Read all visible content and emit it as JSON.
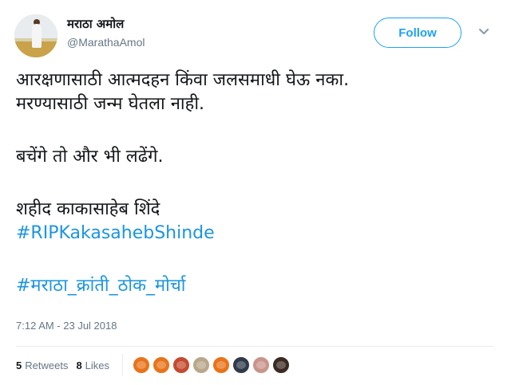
{
  "user": {
    "display_name": "मराठा अमोल",
    "handle": "@MarathaAmol"
  },
  "follow_button": {
    "label": "Follow"
  },
  "tweet": {
    "lines": [
      "आरक्षणासाठी आत्मदहन किंवा जलसमाधी घेऊ नका.",
      "मरण्यासाठी जन्म घेतला नाही.",
      "बचेंगे तो और भी लढेंगे.",
      "शहीद काकासाहेब शिंदे"
    ],
    "hashtags": [
      "#RIPKakasahebShinde",
      "#मराठा_क्रांती_ठोक_मोर्चा"
    ]
  },
  "timestamp": "7:12 AM - 23 Jul 2018",
  "stats": {
    "retweets_count": "5",
    "retweets_label": "Retweets",
    "likes_count": "8",
    "likes_label": "Likes"
  },
  "liker_avatars": [
    {
      "color": "#e8731a"
    },
    {
      "color": "#e8731a"
    },
    {
      "color": "#c44b2e"
    },
    {
      "color": "#b9a78a"
    },
    {
      "color": "#e8731a"
    },
    {
      "color": "#2f3a4a"
    },
    {
      "color": "#c9948a"
    },
    {
      "color": "#3b2a22"
    }
  ],
  "colors": {
    "accent": "#1da1f2",
    "hashtag": "#1b95e0",
    "secondary_text": "#657786"
  }
}
